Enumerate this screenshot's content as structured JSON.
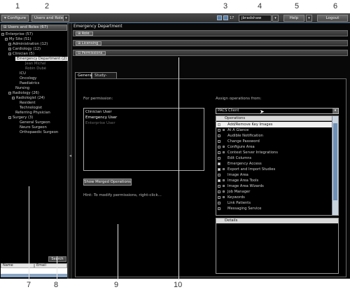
{
  "callouts_top": [
    "1",
    "2",
    "3",
    "4",
    "5",
    "6"
  ],
  "callouts_bottom": [
    "7",
    "8",
    "9",
    "10"
  ],
  "toolbar": {
    "configure_label": "Configure",
    "users_roles_label": "Users and Roles",
    "dropdown_arrow": "▾",
    "status_count": "17",
    "username": "jbradshaw",
    "help_label": "Help",
    "logout_label": "Logout"
  },
  "left_panel": {
    "header": "Users and Roles (67)",
    "tree": [
      {
        "label": "Enterprise (57)",
        "state": "normal"
      },
      {
        "label": "My Site (51)",
        "state": "normal"
      },
      {
        "label": "Administration (12)",
        "state": "normal"
      },
      {
        "label": "Cardiology (12)",
        "state": "normal"
      },
      {
        "label": "Clinician (5)",
        "state": "normal"
      },
      {
        "label": "Emergency Department (2)",
        "state": "selected"
      },
      {
        "label": "Jean Michel",
        "state": "dim"
      },
      {
        "label": "Robin Dubé",
        "state": "dim"
      },
      {
        "label": "ICU",
        "state": "normal"
      },
      {
        "label": "Oncology",
        "state": "normal"
      },
      {
        "label": "Paediatrics",
        "state": "normal"
      },
      {
        "label": "Nursing",
        "state": "normal"
      },
      {
        "label": "Radiology (26)",
        "state": "normal"
      },
      {
        "label": "Radiologist (24)",
        "state": "normal"
      },
      {
        "label": "Resident",
        "state": "normal"
      },
      {
        "label": "Technologist",
        "state": "normal"
      },
      {
        "label": "Referring Physician",
        "state": "normal"
      },
      {
        "label": "Surgery (3)",
        "state": "normal"
      },
      {
        "label": "General Surgeon",
        "state": "normal"
      },
      {
        "label": "Neuro Surgeon",
        "state": "normal"
      },
      {
        "label": "Orthopaedic Surgeon",
        "state": "normal"
      }
    ],
    "search_label": "Search",
    "columns": [
      "Name",
      "Email"
    ]
  },
  "main": {
    "title": "Emergency Department",
    "sections": [
      "Role",
      "Licensing",
      "Permissions"
    ],
    "tabs": [
      "General",
      "Study-Based"
    ],
    "for_permission_label": "For permission:",
    "permissions": [
      {
        "label": "Clinician User",
        "state": "normal"
      },
      {
        "label": "Emergency User",
        "state": "highlight"
      },
      {
        "label": "Enterprise User",
        "state": "dim"
      }
    ],
    "show_merged_label": "Show Merged Operations",
    "hint": "Hint: To modify permissions, right-click...",
    "assign_label": "Assign operations from:",
    "assign_source": "PACS Client",
    "operations_header": "Operations",
    "operations": [
      {
        "label": "Add/Remove Key Images",
        "checked": true,
        "expandable": false,
        "selected": true
      },
      {
        "label": "At A Glance",
        "checked": false,
        "expandable": true,
        "selected": false
      },
      {
        "label": "Audible Notification",
        "checked": false,
        "expandable": false,
        "selected": false
      },
      {
        "label": "Change Password",
        "checked": false,
        "expandable": false,
        "selected": false
      },
      {
        "label": "Configure Area",
        "checked": false,
        "expandable": true,
        "selected": false
      },
      {
        "label": "Context Server Integrations",
        "checked": false,
        "expandable": true,
        "selected": false
      },
      {
        "label": "Edit Columns",
        "checked": false,
        "expandable": false,
        "selected": false
      },
      {
        "label": "Emergency Access",
        "checked": true,
        "expandable": false,
        "selected": false
      },
      {
        "label": "Export and Import Studies",
        "checked": true,
        "expandable": true,
        "selected": false
      },
      {
        "label": "Image Area",
        "checked": false,
        "expandable": false,
        "selected": false
      },
      {
        "label": "Image Area Tools",
        "checked": true,
        "expandable": true,
        "selected": false
      },
      {
        "label": "Image Area Wizards",
        "checked": false,
        "expandable": true,
        "selected": false
      },
      {
        "label": "Job Manager",
        "checked": false,
        "expandable": true,
        "selected": false
      },
      {
        "label": "Keywords",
        "checked": false,
        "expandable": true,
        "selected": false
      },
      {
        "label": "Link Patients",
        "checked": false,
        "expandable": false,
        "selected": false
      },
      {
        "label": "Messaging Service",
        "checked": false,
        "expandable": false,
        "selected": false
      }
    ],
    "details_header": "Details"
  }
}
